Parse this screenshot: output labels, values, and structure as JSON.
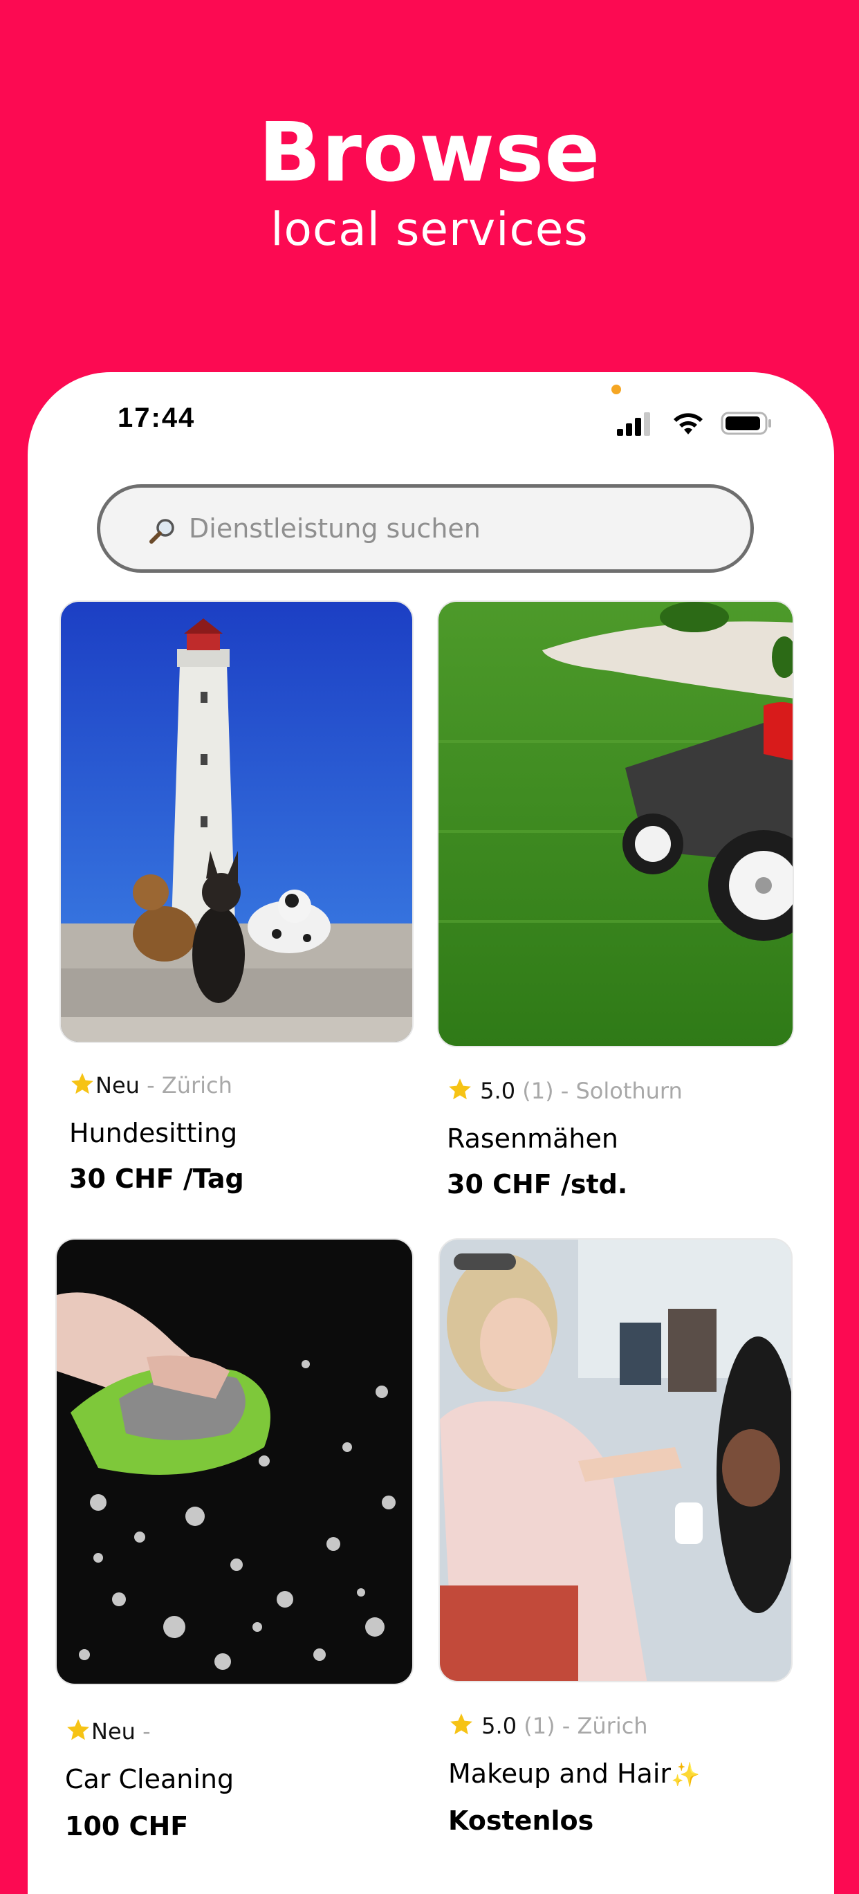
{
  "promo": {
    "title": "Browse",
    "subtitle": "local services"
  },
  "status_bar": {
    "time": "17:44"
  },
  "search": {
    "placeholder": "Dienstleistung suchen"
  },
  "colors": {
    "brand": "#fc0a52",
    "star": "#f6c315"
  },
  "listings": [
    {
      "rating": "Neu",
      "count": "",
      "location": "- Zürich",
      "title": "Hundesitting",
      "price": "30 CHF /Tag",
      "image": "lighthouse-dogs-photo"
    },
    {
      "rating": "5.0",
      "count": "(1)",
      "location": "- Solothurn",
      "title": "Rasenmähen",
      "price": "30 CHF /std.",
      "image": "lawn-mower-photo"
    },
    {
      "rating": "Neu",
      "count": "",
      "location": "-",
      "title": "Car Cleaning",
      "price": "100 CHF",
      "image": "car-wash-photo"
    },
    {
      "rating": "5.0",
      "count": "(1)",
      "location": "- Zürich",
      "title": "Makeup and Hair",
      "title_emoji": "✨",
      "price": "Kostenlos",
      "image": "makeup-artist-photo"
    }
  ]
}
